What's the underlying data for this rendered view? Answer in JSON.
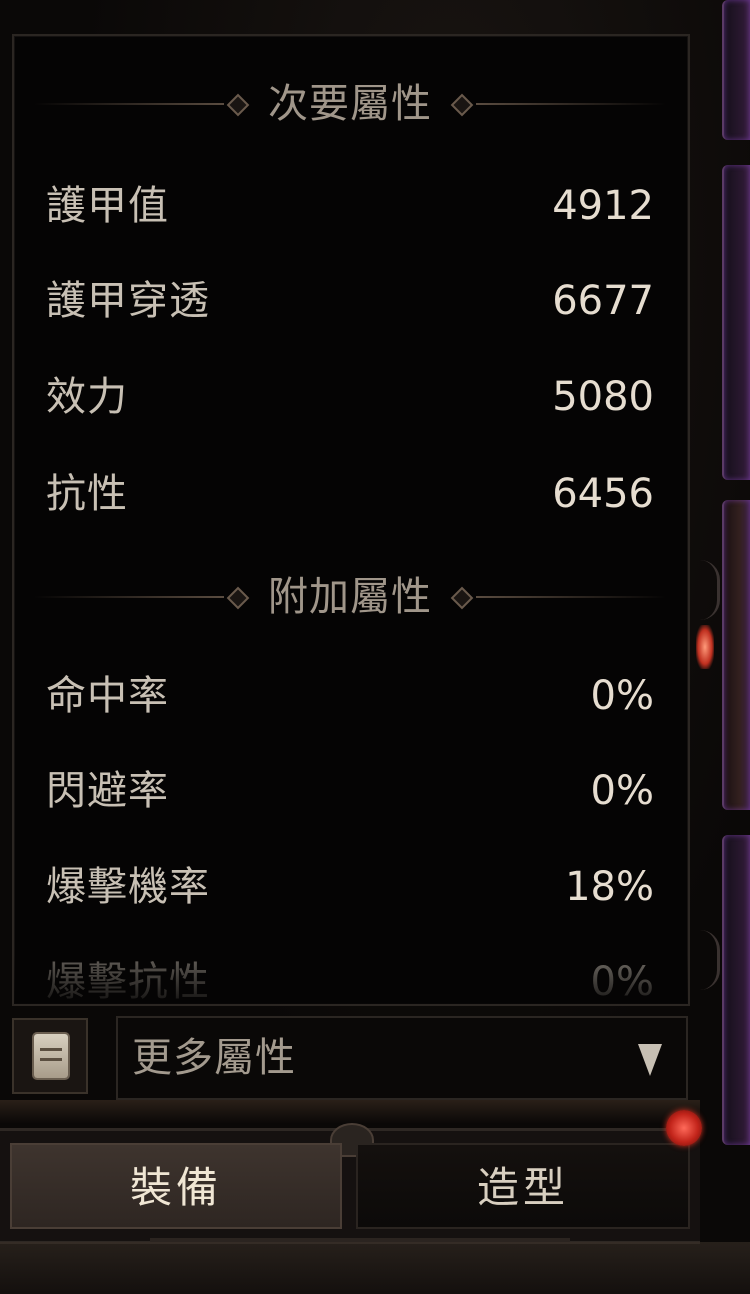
{
  "secondary_section": {
    "title": "次要屬性",
    "stats": [
      {
        "label": "護甲值",
        "value": "4912"
      },
      {
        "label": "護甲穿透",
        "value": "6677"
      },
      {
        "label": "效力",
        "value": "5080"
      },
      {
        "label": "抗性",
        "value": "6456"
      }
    ]
  },
  "additional_section": {
    "title": "附加屬性",
    "stats": [
      {
        "label": "命中率",
        "value": "0%"
      },
      {
        "label": "閃避率",
        "value": "0%"
      },
      {
        "label": "爆擊機率",
        "value": "18%"
      },
      {
        "label": "爆擊抗性",
        "value": "0%"
      }
    ]
  },
  "more_attributes": {
    "label": "更多屬性",
    "book_icon": "book-icon",
    "chevron_icon": "chevron-down-icon"
  },
  "tabs": [
    {
      "label": "裝備",
      "active": true
    },
    {
      "label": "造型",
      "active": false
    }
  ],
  "colors": {
    "panel_bg": "#050404",
    "label_text": "#c8c0b4",
    "value_text": "#e6ddd0",
    "header_text": "#a0968a",
    "notify_red": "#c2241a",
    "edge_purple": "#5a3a66"
  }
}
